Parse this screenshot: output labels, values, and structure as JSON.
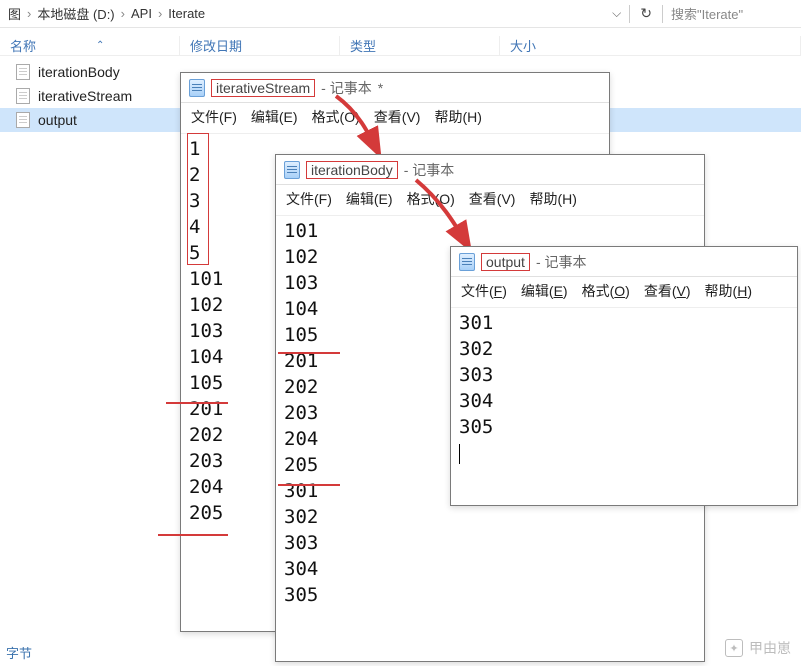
{
  "explorer": {
    "breadcrumb": [
      "图",
      "本地磁盘 (D:)",
      "API",
      "Iterate"
    ],
    "search_placeholder": "搜索\"Iterate\"",
    "columns": {
      "name": "名称",
      "date": "修改日期",
      "type": "类型",
      "size": "大小"
    },
    "files": [
      {
        "name": "iterationBody",
        "selected": false
      },
      {
        "name": "iterativeStream",
        "selected": false
      },
      {
        "name": "output",
        "selected": true
      }
    ],
    "footer": "字节"
  },
  "notepad_suffix": "- 记事本",
  "menus": {
    "plain": [
      "文件(F)",
      "编辑(E)",
      "格式(O)",
      "查看(V)",
      "帮助(H)"
    ],
    "underlined": [
      {
        "t": "文件",
        "k": "F"
      },
      {
        "t": "编辑",
        "k": "E"
      },
      {
        "t": "格式",
        "k": "O"
      },
      {
        "t": "查看",
        "k": "V"
      },
      {
        "t": "帮助",
        "k": "H"
      }
    ]
  },
  "windows": {
    "w1": {
      "title": "iterativeStream",
      "dirty": "*",
      "lines": [
        "1",
        "2",
        "3",
        "4",
        "5",
        "101",
        "102",
        "103",
        "104",
        "105",
        "201",
        "202",
        "203",
        "204",
        "205"
      ]
    },
    "w2": {
      "title": "iterationBody",
      "lines": [
        "101",
        "102",
        "103",
        "104",
        "105",
        "201",
        "202",
        "203",
        "204",
        "205",
        "301",
        "302",
        "303",
        "304",
        "305"
      ]
    },
    "w3": {
      "title": "output",
      "lines": [
        "301",
        "302",
        "303",
        "304",
        "305"
      ]
    }
  },
  "watermark": "甲由崽"
}
